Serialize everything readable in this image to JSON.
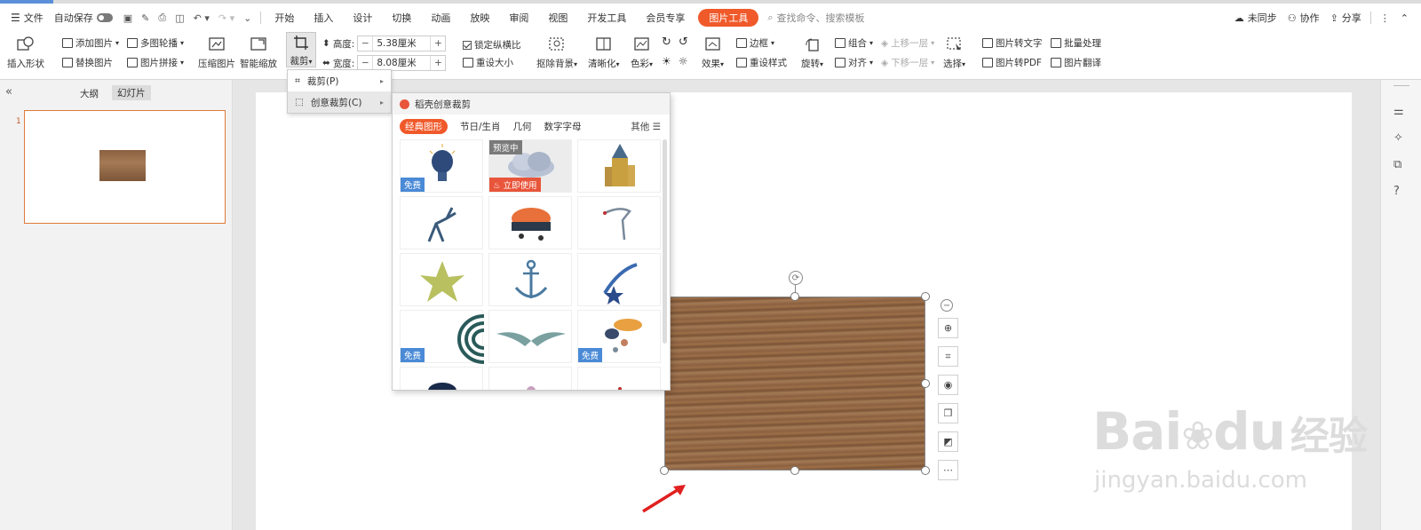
{
  "menubar": {
    "file": "文件",
    "autosave": "自动保存",
    "tabs": [
      "开始",
      "插入",
      "设计",
      "切换",
      "动画",
      "放映",
      "审阅",
      "视图",
      "开发工具",
      "会员专享"
    ],
    "active_tab": "图片工具",
    "search": "查找命令、搜索模板",
    "sync": "未同步",
    "collab": "协作",
    "share": "分享"
  },
  "ribbon": {
    "insert_shape": "插入形状",
    "add_image": "添加图片",
    "replace_image": "替换图片",
    "multi_outline": "多图轮播",
    "image_splice": "图片拼接",
    "compress": "压缩图片",
    "smart_zoom": "智能缩放",
    "crop": "裁剪",
    "height_label": "高度:",
    "height_value": "5.38厘米",
    "width_label": "宽度:",
    "width_value": "8.08厘米",
    "lock_ratio": "锁定纵横比",
    "reset_size": "重设大小",
    "remove_bg": "抠除背景",
    "sharpen": "清晰化",
    "color": "色彩",
    "effect": "效果",
    "border": "边框",
    "reset_style": "重设样式",
    "rotate": "旋转",
    "group": "组合",
    "align": "对齐",
    "bring_forward": "上移一层",
    "send_backward": "下移一层",
    "select": "选择",
    "img_to_text": "图片转文字",
    "img_to_pdf": "图片转PDF",
    "batch": "批量处理",
    "translate": "图片翻译"
  },
  "leftpanel": {
    "outline_tab": "大纲",
    "slides_tab": "幻灯片",
    "slide_number": "1"
  },
  "crop_menu": {
    "crop": "裁剪(P)",
    "creative_crop": "创意裁剪(C)"
  },
  "creative_panel": {
    "header": "稻壳创意裁剪",
    "categories": [
      "经典图形",
      "节日/生肖",
      "几何",
      "数字字母"
    ],
    "more": "其他",
    "preview_tag": "预览中",
    "use_now": "立即使用",
    "free": "免费"
  },
  "watermark": {
    "brand_a": "Bai",
    "brand_b": "du",
    "brand_c": "经验",
    "url": "jingyan.baidu.com"
  },
  "colors": {
    "accent": "#f0592a",
    "badge": "#4a8ad6",
    "wood": "#8a6040"
  }
}
